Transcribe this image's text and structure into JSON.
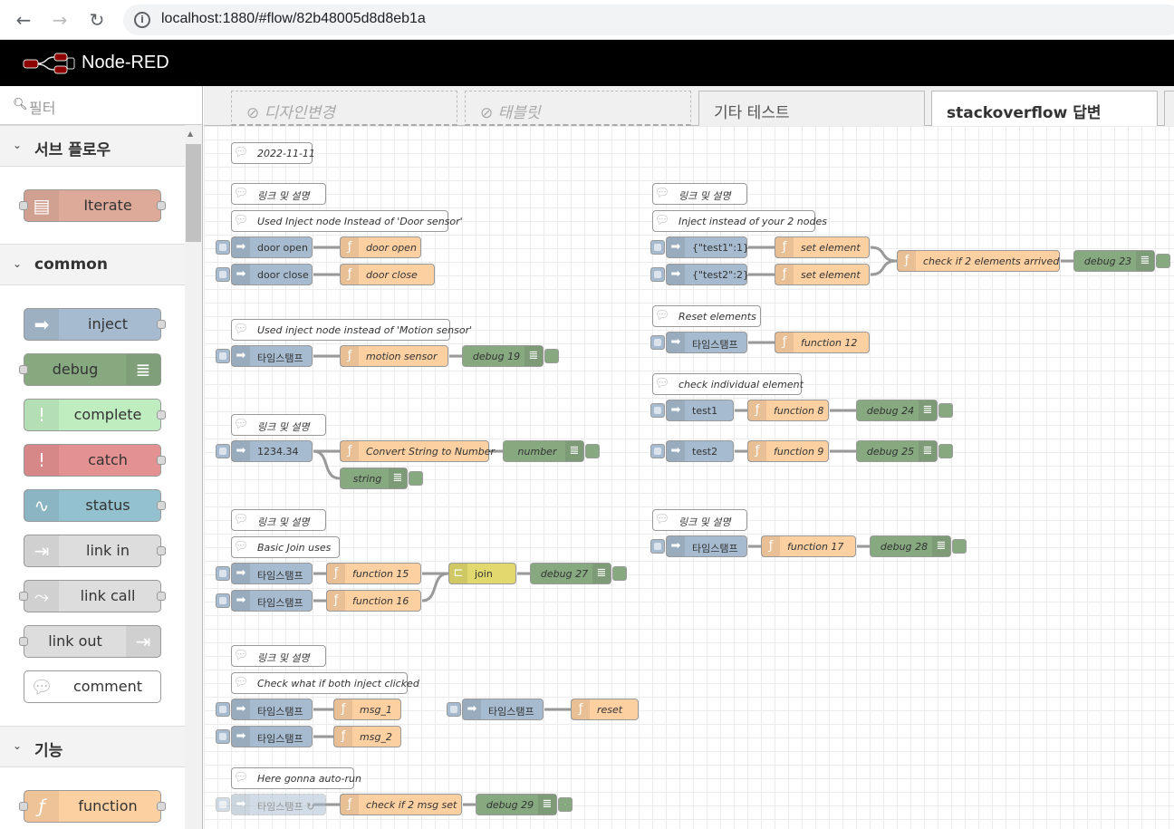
{
  "browser": {
    "url": "localhost:1880/#flow/82b48005d8d8eb1a"
  },
  "app": {
    "title": "Node-RED"
  },
  "palette": {
    "filter_placeholder": "필터",
    "categories": [
      {
        "label": "서브 플로우",
        "nodes": [
          "Iterate"
        ]
      },
      {
        "label": "common",
        "nodes": [
          "inject",
          "debug",
          "complete",
          "catch",
          "status",
          "link in",
          "link call",
          "link out",
          "comment"
        ]
      },
      {
        "label": "기능",
        "nodes": [
          "function"
        ]
      }
    ]
  },
  "tabs": [
    "디자인변경",
    "태블릿",
    "기타 테스트",
    "stackoverflow 답변"
  ],
  "colors": {
    "inject": "#a6bbcf",
    "function": "#fdd0a2",
    "debug": "#87a980",
    "join": "#e2d96e",
    "complete": "#c0edc0",
    "catch": "#e49191",
    "status": "#94c1d0",
    "link": "#dddddd",
    "subflow": "#ddaa99"
  },
  "canvas": {
    "comments": [
      "2022-11-11",
      "링크 및 설명",
      "Used Inject node Instead of 'Door sensor'",
      "Used inject node instead of 'Motion sensor'",
      "링크 및 설명",
      "링크 및 설명",
      "Basic Join uses",
      "링크 및 설명",
      "Check what if both inject clicked",
      "Here gonna auto-run",
      "링크 및 설명",
      "Inject instead of your 2 nodes",
      "Reset elements",
      "check individual element",
      "링크 및 설명"
    ],
    "injects": [
      "door open",
      "door close",
      "타임스탬프",
      "1234.34",
      "타임스탬프",
      "타임스탬프",
      "타임스탬프",
      "타임스탬프",
      "타임스탬프",
      "타임스탬프 ↻",
      "{\"test1\":1}",
      "{\"test2\":2}",
      "타임스탬프",
      "test1",
      "test2",
      "타임스탬프"
    ],
    "functions": [
      "door open",
      "door close",
      "motion sensor",
      "Convert String to Number",
      "function 15",
      "function 16",
      "msg_1",
      "msg_2",
      "reset",
      "check if 2 msg set",
      "set element",
      "set element",
      "check if 2 elements arrived",
      "function 12",
      "function 8",
      "function 9",
      "function 17"
    ],
    "debugs": [
      "debug 19",
      "number",
      "string",
      "debug 27",
      "debug 29",
      "debug 23",
      "debug 24",
      "debug 25",
      "debug 28"
    ],
    "joins": [
      "join"
    ]
  }
}
